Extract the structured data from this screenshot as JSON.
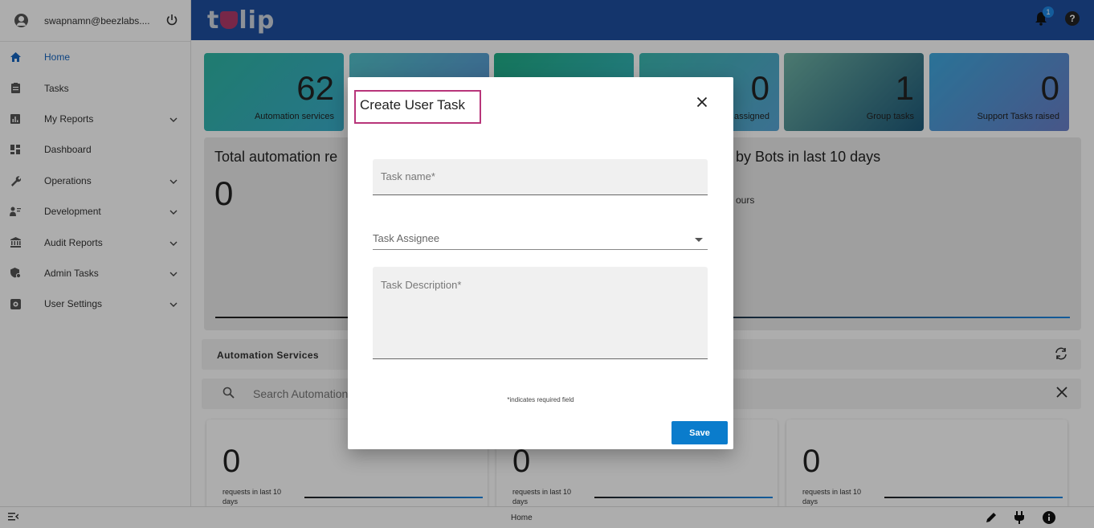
{
  "sidebar": {
    "user_email": "swapnamn@beezlabs....",
    "items": [
      {
        "label": "Home",
        "icon": "home-icon",
        "active": true
      },
      {
        "label": "Tasks",
        "icon": "clipboard-icon"
      },
      {
        "label": "My Reports",
        "icon": "report-icon",
        "expandable": true
      },
      {
        "label": "Dashboard",
        "icon": "dashboard-icon"
      },
      {
        "label": "Operations",
        "icon": "wrench-icon",
        "expandable": true
      },
      {
        "label": "Development",
        "icon": "developer-icon",
        "expandable": true
      },
      {
        "label": "Audit Reports",
        "icon": "bank-icon",
        "expandable": true
      },
      {
        "label": "Admin Tasks",
        "icon": "admin-shield-icon",
        "expandable": true
      },
      {
        "label": "User Settings",
        "icon": "settings-icon",
        "expandable": true
      }
    ]
  },
  "header": {
    "logo_text": "tulip",
    "notification_count": "1"
  },
  "stats": [
    {
      "value": "62",
      "label": "Automation services"
    },
    {
      "value": "",
      "label": ""
    },
    {
      "value": "",
      "label": ""
    },
    {
      "value": "0",
      "label": "assigned"
    },
    {
      "value": "1",
      "label": "Group tasks"
    },
    {
      "value": "0",
      "label": "Support Tasks raised"
    }
  ],
  "panel": {
    "title_left": "Total automation re",
    "value": "0",
    "title_right": "by Bots in last 10 days",
    "sub_right": "ours"
  },
  "automation": {
    "section_title": "Automation Services",
    "search_placeholder": "Search Automation S"
  },
  "cards": [
    {
      "value": "0",
      "label": "requests in last 10 days"
    },
    {
      "value": "0",
      "label": "requests in last 10 days"
    },
    {
      "value": "0",
      "label": "requests in last 10 days"
    }
  ],
  "footer": {
    "page_name": "Home"
  },
  "modal": {
    "title": "Create User Task",
    "task_name_placeholder": "Task name*",
    "task_assignee_label": "Task Assignee",
    "task_description_placeholder": "Task Description*",
    "required_note": "*indicates required field",
    "save_label": "Save"
  },
  "colors": {
    "header_bg": "#1e4fa0",
    "active_nav": "#1565c0",
    "save_button": "#0a7ccc",
    "highlight_box": "#b8357a"
  }
}
